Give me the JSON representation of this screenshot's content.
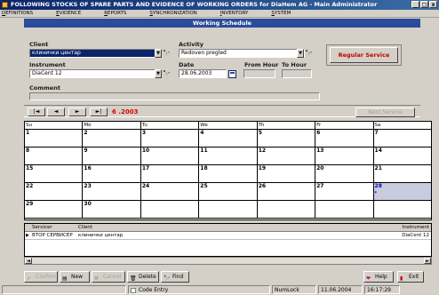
{
  "window": {
    "title": "FOLLOWING STOCKS OF SPARE PARTS AND EVIDENCE OF WORKING ORDERS for DiaHem AG - Main Administrator",
    "controls": [
      "_",
      "□",
      "x"
    ]
  },
  "menu": [
    "DEFINITIONS",
    "EVIDENCE",
    "REPORTS",
    "SYNCHRONIZATION",
    "INVENTORY",
    "SYSTEM"
  ],
  "header": {
    "title": "Working Schedule"
  },
  "form": {
    "client_label": "Client",
    "client_value": "клинички центар",
    "activity_label": "Activity",
    "activity_value": "Redoven pregled",
    "instrument_label": "Instrument",
    "instrument_value": "DiaCent 12",
    "date_label": "Date",
    "date_value": "28.06.2003",
    "from_hour_label": "From Hour",
    "from_hour_value": "",
    "to_hour_label": "To Hour",
    "to_hour_value": "",
    "comment_label": "Comment",
    "comment_value": "",
    "regular_service_button": "Regular Service"
  },
  "nav": {
    "first": "|◄",
    "prev": "◄",
    "next": "►",
    "last": "►|",
    "month_label": "6 .2003",
    "next_service_button": "Next Service"
  },
  "calendar": {
    "weekdays": [
      "Su",
      "Mo",
      "Tu",
      "We",
      "Th",
      "Fr",
      "Sa"
    ],
    "weeks": [
      [
        "1",
        "2",
        "3",
        "4",
        "5",
        "6",
        "7"
      ],
      [
        "8",
        "9",
        "10",
        "11",
        "12",
        "13",
        "14"
      ],
      [
        "15",
        "16",
        "17",
        "18",
        "19",
        "20",
        "21"
      ],
      [
        "22",
        "23",
        "24",
        "25",
        "26",
        "27",
        "28"
      ],
      [
        "29",
        "30",
        "",
        "",
        "",
        "",
        ""
      ]
    ],
    "highlighted_day": "28",
    "highlight_mark": "*"
  },
  "servicer_grid": {
    "columns": [
      "Servicer",
      "Client",
      "Instrument"
    ],
    "rows": [
      {
        "servicer": "ВТОР СЕРВИСЕР",
        "client": "клинички центар",
        "instrument": "DiaCent 12"
      }
    ]
  },
  "toolbar": {
    "confirm": "Confirm",
    "new": "New",
    "cancel": "Cancel",
    "delete": "Delete",
    "find": "Find",
    "help": "Help",
    "exit": "Exit"
  },
  "status": {
    "code_entry": "Code Entry",
    "numlock": "NumLock",
    "date": "11.06.2004",
    "time": "16:17:29"
  }
}
